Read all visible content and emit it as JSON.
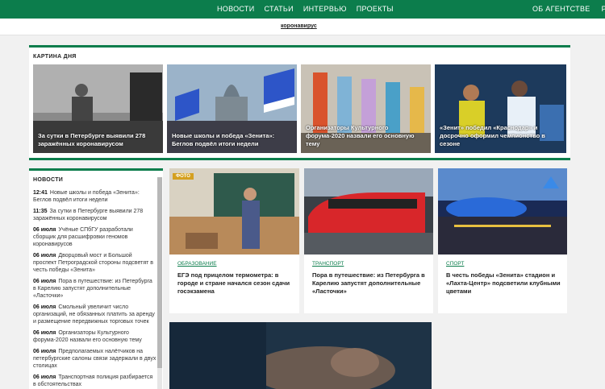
{
  "top_nav": {
    "items": [
      "НОВОСТИ",
      "СТАТЬИ",
      "ИНТЕРВЬЮ",
      "ПРОЕКТЫ"
    ],
    "right_items": [
      "ОБ АГЕНТСТВЕ",
      "РЕ"
    ]
  },
  "tag_link": "коронавирус",
  "day": {
    "title": "КАРТИНА ДНЯ",
    "cards": [
      {
        "caption": "За сутки в Петербурге выявили 278 заражённых коронавирусом"
      },
      {
        "caption": "Новые школы и победа «Зенита»: Беглов подвёл итоги недели"
      },
      {
        "caption": "Организаторы Культурного форума-2020 назвали его основную тему"
      },
      {
        "caption": "«Зенит» победил «Краснодар» и досрочно оформил чемпионство в сезоне"
      }
    ]
  },
  "news": {
    "title": "НОВОСТИ",
    "items": [
      {
        "time": "12:41",
        "text": "Новые школы и победа «Зенита»: Беглов подвёл итоги недели"
      },
      {
        "time": "11:35",
        "text": "За сутки в Петербурге выявили 278 заражённых коронавирусом"
      },
      {
        "time": "06 июля",
        "text": "Учёные СПбГУ разработали сборщик для расшифровки геномов коронавирусов"
      },
      {
        "time": "06 июля",
        "text": "Дворцовый мост и Большой проспект Петроградской стороны подсветят в честь победы «Зенита»"
      },
      {
        "time": "06 июля",
        "text": "Пора в путешествие: из Петербурга в Карелию запустят дополнительные «Ласточки»"
      },
      {
        "time": "06 июля",
        "text": "Смольный увеличит число организаций, не обязанных платить за аренду и размещение передвижных торговых точек"
      },
      {
        "time": "06 июля",
        "text": "Организаторы Культурного форума-2020 назвали его основную тему"
      },
      {
        "time": "06 июля",
        "text": "Предполагаемых налётчиков на петербургские салоны связи задержали в двух столицах"
      },
      {
        "time": "06 июля",
        "text": "Транспортная полиция разбирается в обстоятельствах"
      }
    ]
  },
  "cards": [
    {
      "badge": "ФОТО",
      "category": "ОБРАЗОВАНИЕ",
      "headline": "ЕГЭ под прицелом термометра: в городе и стране начался сезон сдачи госэкзамена"
    },
    {
      "category": "ТРАНСПОРТ",
      "headline": "Пора в путешествие: из Петербурга в Карелию запустят дополнительные «Ласточки»"
    },
    {
      "category": "СПОРТ",
      "headline": "В честь победы «Зенита» стадион и «Лахта-Центр» подсветили клубными цветами"
    }
  ]
}
